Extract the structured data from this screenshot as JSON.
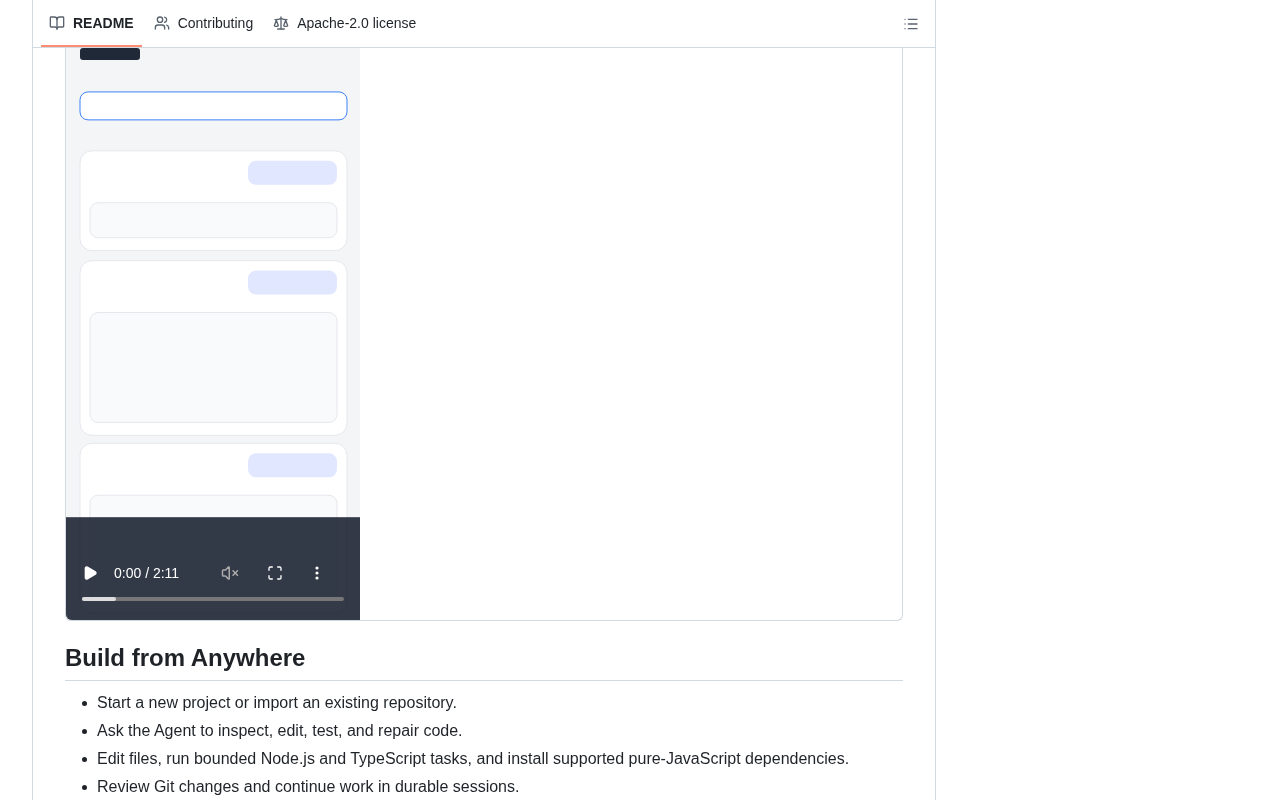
{
  "tabs": [
    {
      "label": "README",
      "kind": "readme",
      "selected": true
    },
    {
      "label": "Contributing",
      "kind": "people",
      "selected": false
    },
    {
      "label": "Apache-2.0 license",
      "kind": "scale",
      "selected": false
    }
  ],
  "video": {
    "playing": false,
    "muted": true,
    "time": "0:00 / 2:11",
    "level": 0.13
  },
  "section": {
    "heading": "Build from Anywhere",
    "items": [
      "Start a new project or import an existing repository.",
      "Ask the Agent to inspect, edit, test, and repair code.",
      "Edit files, run bounded Node.js and TypeScript tasks, and install supported pure-JavaScript dependencies.",
      "Review Git changes and continue work in durable sessions."
    ]
  }
}
